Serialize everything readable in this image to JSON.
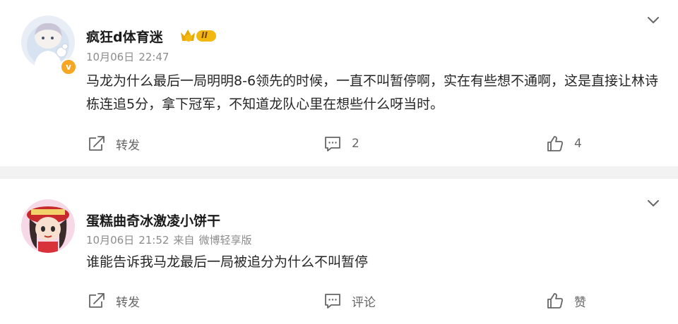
{
  "posts": [
    {
      "username": "疯狂d体育迷",
      "badge_text": "II",
      "date": "10月06日",
      "time": "22:47",
      "source_prefix": "",
      "source": "",
      "verified_mark": "v",
      "content": "马龙为什么最后一局明明8-6领先的时候，一直不叫暂停啊，实在有些想不通啊，这是直接让林诗栋连追5分，拿下冠军，不知道龙队心里在想些什么呀当时。",
      "repost_label": "转发",
      "comment_label": "2",
      "like_label": "4"
    },
    {
      "username": "蛋糕曲奇冰激凌小饼干",
      "date": "10月06日",
      "time": "21:52",
      "source_prefix": "来自",
      "source": "微博轻享版",
      "content": "谁能告诉我马龙最后一局被追分为什么不叫暂停",
      "repost_label": "转发",
      "comment_label": "评论",
      "like_label": "赞"
    }
  ],
  "icons": {
    "chevron": "chevron-down-icon",
    "repost": "repost-icon",
    "comment": "comment-icon",
    "like": "like-icon"
  },
  "colors": {
    "badge_gold": "#e8a800",
    "verified_orange": "#f6a623",
    "separator": "#f2f2f2",
    "meta_gray": "#8c8c8c"
  }
}
